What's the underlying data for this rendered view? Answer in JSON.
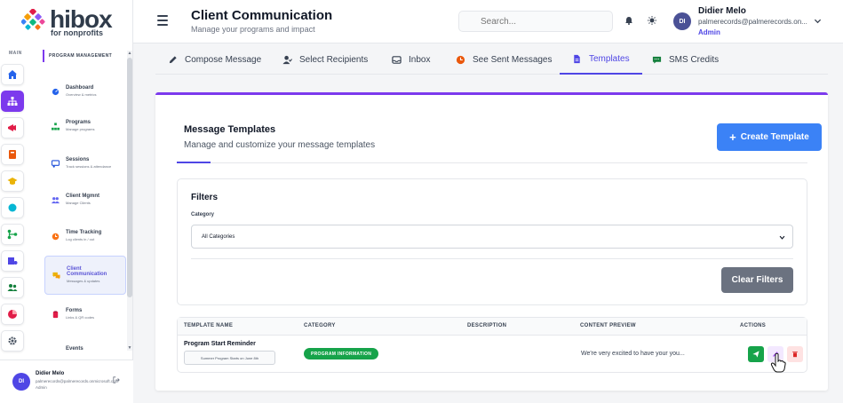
{
  "brand": {
    "name": "hibox",
    "tagline": "for nonprofits",
    "colors": {
      "accent": "#7c3aed",
      "primary": "#4f46e5",
      "button": "#3b82f6"
    }
  },
  "rail": {
    "label": "MAIN",
    "icons": [
      "home-icon",
      "sitemap-icon",
      "megaphone-icon",
      "book-icon",
      "graduation-icon",
      "circle-icon",
      "branch-icon",
      "chart-user-icon",
      "users-icon",
      "pie-icon",
      "gear-icon"
    ],
    "active_index": 1
  },
  "sidebar": {
    "section": "PROGRAM MANAGEMENT",
    "items": [
      {
        "title": "Dashboard",
        "subtitle": "Overview & metrics",
        "icon": "dashboard-icon"
      },
      {
        "title": "Programs",
        "subtitle": "Manage programs",
        "icon": "sitemap-icon"
      },
      {
        "title": "Sessions",
        "subtitle": "Track sessions & attendance",
        "icon": "sessions-icon"
      },
      {
        "title": "Client Mgmnt",
        "subtitle": "Manage Clients",
        "icon": "users-icon"
      },
      {
        "title": "Time Tracking",
        "subtitle": "Log clients in / out",
        "icon": "clock-icon"
      },
      {
        "title": "Client Communication",
        "subtitle": "Messages & updates",
        "icon": "chat-icon"
      },
      {
        "title": "Forms",
        "subtitle": "Links & QR codes",
        "icon": "forms-icon"
      },
      {
        "title": "Events",
        "subtitle": "",
        "icon": ""
      }
    ],
    "active_index": 5
  },
  "sidebar_user": {
    "initials": "DI",
    "name": "Didier Melo",
    "email": "palmerecords@palmerecords.onmicrosoft.com",
    "role": "Admin"
  },
  "header": {
    "title": "Client Communication",
    "subtitle": "Manage your programs and impact",
    "search_placeholder": "Search...",
    "user": {
      "initials": "DI",
      "name": "Didier Melo",
      "email": "palmerecords@palmerecords.on...",
      "role": "Admin"
    }
  },
  "tabs": [
    {
      "label": "Compose Message",
      "icon": "pencil-icon"
    },
    {
      "label": "Select Recipients",
      "icon": "user-check-icon"
    },
    {
      "label": "Inbox",
      "icon": "inbox-icon"
    },
    {
      "label": "See Sent Messages",
      "icon": "clock-icon"
    },
    {
      "label": "Templates",
      "icon": "file-icon"
    },
    {
      "label": "SMS Credits",
      "icon": "sms-icon"
    }
  ],
  "active_tab": 4,
  "templates": {
    "title": "Message Templates",
    "subtitle": "Manage and customize your message templates",
    "create_button": "Create Template"
  },
  "filters": {
    "title": "Filters",
    "category_label": "Category",
    "category_value": "All Categories",
    "clear_button": "Clear Filters"
  },
  "table": {
    "columns": [
      "TEMPLATE NAME",
      "CATEGORY",
      "DESCRIPTION",
      "CONTENT PREVIEW",
      "ACTIONS"
    ],
    "rows": [
      {
        "name": "Program Start Reminder",
        "subject": "Summer Program Starts on June 8th",
        "category": "PROGRAM INFORMATION",
        "description": "",
        "preview": "We're very excited to have your you..."
      }
    ]
  }
}
